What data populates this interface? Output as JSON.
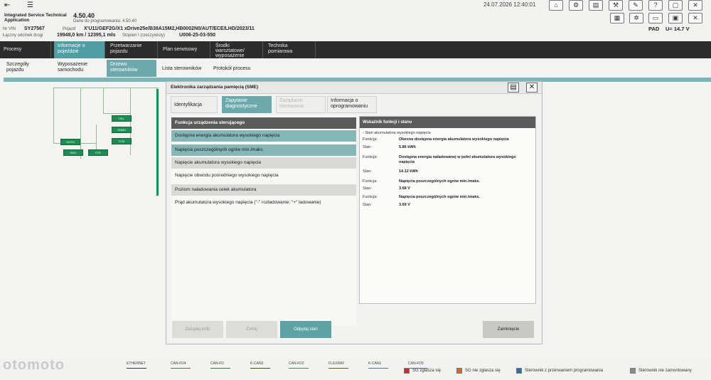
{
  "header": {
    "app_name": "Integrated Service Technical Application",
    "version": "4.50.40",
    "programmed_label": "Dane do programowania:",
    "programmed_value": "4.50.40",
    "datetime": "24.07.2026 12:40:01",
    "vin_label": "Nr VIN",
    "vin_value": "SY27567",
    "vehicle_label": "Pojazd",
    "vehicle_value": "X'U11/GEF2G/X1 xDrive25e/B38A15M2,HB0002N0/AUT/ECE/LHD/2023/11",
    "mileage_label": "Łączny odcinek drogi",
    "mileage_value": "19948,0 km / 12395,1 mls",
    "level_label": "Stopień I (rzeczywisty)",
    "level_value": "U006-25-03-550",
    "pad_label": "PAD",
    "voltage_label": "U=",
    "voltage_value": "14.7 V"
  },
  "nav_main": {
    "items": [
      {
        "label": "Procesy"
      },
      {
        "label": "Informacje o pojeździe"
      },
      {
        "label": "Przetwarzanie pojazdu"
      },
      {
        "label": "Plan serwisowy"
      },
      {
        "label": "Środki warsztatowe/ wyposażenie"
      },
      {
        "label": "Technika pomiarowa"
      }
    ]
  },
  "nav_sub": {
    "items": [
      {
        "label": "Szczegóły pojazdu"
      },
      {
        "label": "Wyposażenie samochodu"
      },
      {
        "label": "Drzewo sterowników"
      },
      {
        "label": "Lista sterowników"
      },
      {
        "label": "Protokół procesu"
      }
    ]
  },
  "dialog": {
    "title": "Elektronika zarządzania pamięcią (SME)",
    "tabs": [
      {
        "label": "Identyfikacja"
      },
      {
        "label": "Zapytanie diagnostyczne"
      },
      {
        "label": "Zażądanie sterowania"
      },
      {
        "label": "Informacja o oprogramowaniu"
      }
    ],
    "functions_header": "Funkcja urządzenia sterującego",
    "functions": [
      {
        "label": "Dostępna energia akumulatora wysokiego napięcia"
      },
      {
        "label": "Napięcia poszczególnych ogniw min./maks."
      },
      {
        "label": "Napięcie akumulatora wysokiego napięcia"
      },
      {
        "label": "Napięcie obwodu pośredniego wysokiego napięcia"
      },
      {
        "label": "Poziom naładowania celek akumulatora"
      },
      {
        "label": "Prąd akumulatora wysokiego napięcia (\"-\" rozładowanie; \"+\" ładowanie)"
      }
    ],
    "detail_header": "Wskaźnik funkcji i stanu",
    "detail_section": "- Stan akumulatora wysokiego napięcia",
    "func_label": "Funkcja:",
    "state_label": "Stan:",
    "details": [
      {
        "func": "Obecna dostępna energia akumulatora wysokiego napięcia",
        "state": "5.86 kWh"
      },
      {
        "func": "Dostępna energia naładowanej w pełni akumulatora wysokiego napięcia",
        "state": "14.12 kWh"
      },
      {
        "func": "Napięcia poszczególnych ogniw min./maks.",
        "state": "3.68 V"
      },
      {
        "func": "Napięcia poszczególnych ogniw min./maks.",
        "state": "3.69 V"
      }
    ],
    "buttons": {
      "b1": "Zażądaj prób",
      "b2": "Cofnij",
      "b3": "Odpytaj stan",
      "close": "Zamknięcie"
    }
  },
  "legend": {
    "lines": [
      {
        "label": "ETHERNET",
        "color": "#3a3a3a"
      },
      {
        "label": "CAN-FD4",
        "color": "#c04040"
      },
      {
        "label": "CAN-FD",
        "color": "#2f7a3a"
      },
      {
        "label": "K-CAN3",
        "color": "#2f3f8f"
      },
      {
        "label": "CAN-FD2",
        "color": "#b5486a"
      },
      {
        "label": "FLEXRAY",
        "color": "#6a3fa0"
      },
      {
        "label": "K-CAN1",
        "color": "#b04090"
      },
      {
        "label": "CAN-FD5",
        "color": "#4a6fa8"
      }
    ],
    "states": [
      {
        "label": "SG zgłasza się",
        "color": "#c43030"
      },
      {
        "label": "SG nie zgłasza się",
        "color": "#d06a2a"
      },
      {
        "label": "Sterownik z przerwaniem programowania",
        "color": "#2a6fa8"
      },
      {
        "label": "Sterownik nie zamontowany",
        "color": "#8a8a8a"
      }
    ]
  },
  "tree": {
    "nodes": [
      {
        "label": "HKL"
      },
      {
        "label": "SNMH"
      },
      {
        "label": "FCM"
      },
      {
        "label": "HKFM"
      },
      {
        "label": "SMO"
      },
      {
        "label": "FZD"
      }
    ]
  },
  "watermark": "otomoto"
}
